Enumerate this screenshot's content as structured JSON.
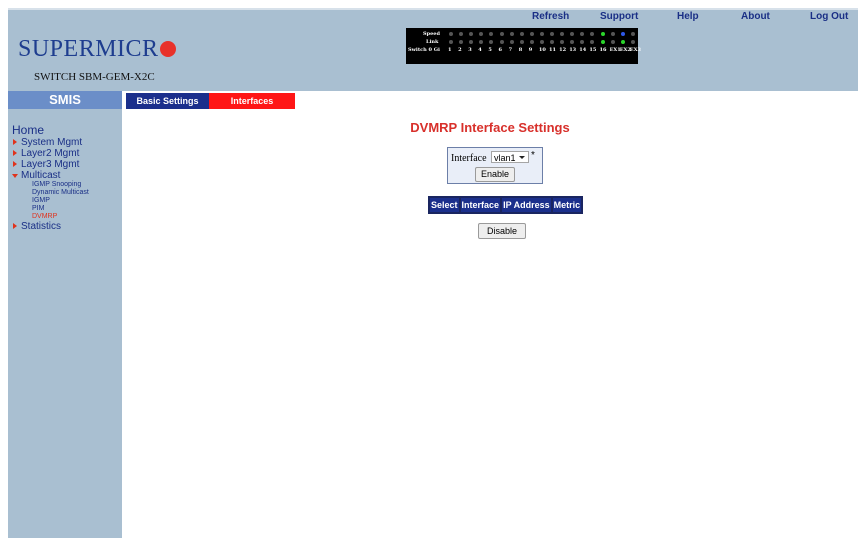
{
  "header": {
    "logo_text": "SUPERMICR",
    "model": "SWITCH SBM-GEM-X2C",
    "top_links": [
      "Refresh",
      "Support",
      "Help",
      "About",
      "Log Out"
    ],
    "port_panel": {
      "speed_label": "Speed",
      "link_label": "Link",
      "switch_label": "Switch 0 Gi",
      "port_numbers": [
        "1",
        "2",
        "3",
        "4",
        "5",
        "6",
        "7",
        "8",
        "9",
        "10",
        "11",
        "12",
        "13",
        "14",
        "15",
        "16",
        "EX1",
        "EX2",
        "EX3"
      ]
    }
  },
  "sidebar": {
    "title": "SMIS",
    "home": "Home",
    "items": [
      "System Mgmt",
      "Layer2 Mgmt",
      "Layer3 Mgmt",
      "Multicast"
    ],
    "multicast_subitems": [
      "IGMP Snooping",
      "Dynamic Multicast",
      "IGMP",
      "PIM",
      "DVMRP"
    ],
    "last_item": "Statistics"
  },
  "tabs": {
    "basic": "Basic Settings",
    "interfaces": "Interfaces"
  },
  "main": {
    "title": "DVMRP Interface Settings",
    "interface_label": "Interface",
    "interface_value": "vlan1",
    "required_mark": "*",
    "enable_label": "Enable",
    "columns": [
      "Select",
      "Interface",
      "IP Address",
      "Metric"
    ],
    "disable_label": "Disable"
  },
  "colors": {
    "header_bg": "#a9bfd1",
    "accent_red": "#d8302b",
    "nav_blue": "#1b2f8c",
    "active_tab": "#ff1616"
  }
}
